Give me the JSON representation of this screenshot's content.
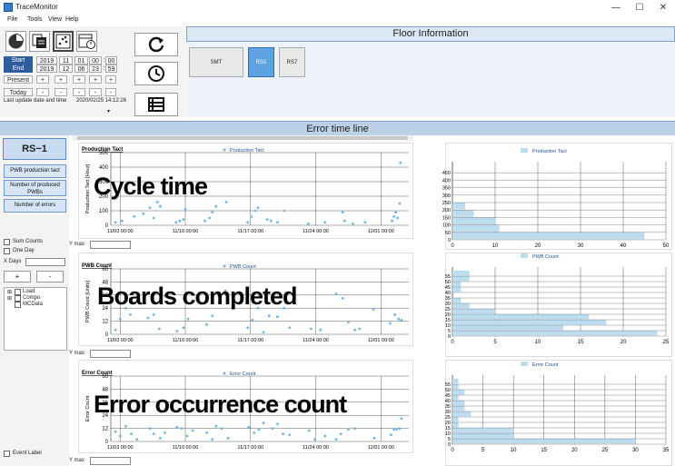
{
  "window": {
    "title": "TraceMonitor",
    "minimize": "—",
    "maximize": "☐",
    "close": "✕"
  },
  "menu": [
    "File",
    "Tools",
    "View",
    "Help"
  ],
  "time_grid": {
    "rows": [
      {
        "label": "Start",
        "cells": [
          "2019",
          "11",
          "01",
          "00",
          ":",
          "00"
        ]
      },
      {
        "label": "End",
        "cells": [
          "2019",
          "12",
          "06",
          "23",
          ":",
          "59"
        ]
      },
      {
        "label": "Present",
        "cells": [
          "+",
          "+",
          "+",
          "+",
          "+"
        ]
      },
      {
        "label": "Today",
        "cells": [
          "-",
          "-",
          "-",
          "-",
          "-"
        ]
      }
    ],
    "last_update_label": "Last update date and time",
    "last_update_value": "2020/02/25 14:12:26"
  },
  "floor": {
    "header": "Floor Information",
    "buttons": [
      "SMT",
      "RS1",
      "RS7"
    ],
    "selected": "RS1"
  },
  "timeline": {
    "header": "Error time line"
  },
  "left": {
    "station": "RS−1",
    "buttons": [
      "PWB production tact",
      "Number of produced PWBs",
      "Number of errors"
    ],
    "sum_counts": "Sum Counts",
    "one_day": "One Day",
    "x_days": "X Days",
    "plus": "+",
    "minus": "-",
    "tree": [
      "Load",
      "Compo",
      "MCData"
    ],
    "event_label": "Event Label"
  },
  "overlays": [
    "Cycle time",
    "Boards completed",
    "Error occurrence count"
  ],
  "ymax_label": "Y max",
  "colors": {
    "accent": "#6fb6de",
    "bar": "#bcdcef",
    "header": "#bcd0e8"
  },
  "chart_data": [
    {
      "type": "scatter",
      "title": "Production Tact",
      "legend": "Production Tact",
      "ylabel": "Production Tact [Hour]",
      "yticks": [
        0,
        100,
        200,
        300,
        400,
        500
      ],
      "ylim": [
        0,
        500
      ],
      "xticks": [
        "11/03 00:00",
        "11/10 00:00",
        "11/17 00:00",
        "11/24 00:00",
        "12/01 00:00"
      ],
      "x": [
        0.5,
        1.2,
        2.5,
        3.5,
        4.2,
        4.6,
        5.0,
        5.3,
        7.0,
        7.4,
        7.8,
        8.0,
        10.1,
        10.6,
        10.9,
        11.3,
        12.4,
        14.7,
        15.1,
        15.5,
        15.8,
        16.8,
        17.2,
        17.9,
        18.6,
        21.2,
        23.0,
        24.9,
        25.1,
        26.0,
        27.3,
        30.2,
        30.4,
        30.6,
        30.8,
        31.0,
        31.1
      ],
      "y": [
        20,
        30,
        60,
        80,
        120,
        50,
        160,
        130,
        20,
        30,
        40,
        110,
        30,
        50,
        90,
        130,
        160,
        20,
        60,
        100,
        120,
        40,
        30,
        20,
        100,
        10,
        20,
        90,
        30,
        10,
        20,
        30,
        60,
        90,
        50,
        150,
        430
      ]
    },
    {
      "type": "bar",
      "orientation": "horizontal",
      "legend": "Production Tact",
      "categories": [
        0,
        50,
        100,
        150,
        200,
        250,
        300,
        350,
        400,
        450
      ],
      "values": [
        45,
        11,
        10,
        5,
        3,
        0,
        0,
        0,
        0,
        0
      ],
      "xlim": [
        0,
        50
      ],
      "xticks": [
        0,
        10,
        20,
        30,
        40,
        50
      ]
    },
    {
      "type": "scatter",
      "title": "PWB Count",
      "legend": "PWB Count",
      "ylabel": "PWB Count [Units]",
      "yticks": [
        0,
        12,
        24,
        36,
        48,
        60
      ],
      "ylim": [
        0,
        60
      ],
      "xticks": [
        "11/03 00:00",
        "11/10 00:00",
        "11/17 00:00",
        "11/24 00:00",
        "12/01 00:00"
      ],
      "x": [
        0.5,
        1.0,
        1.6,
        2.1,
        4.0,
        4.6,
        5.2,
        5.8,
        7.1,
        7.8,
        8.3,
        10.3,
        10.9,
        11.6,
        12.3,
        14.7,
        15.2,
        15.8,
        16.4,
        17.0,
        17.9,
        18.6,
        19.2,
        21.5,
        22.5,
        24.2,
        24.9,
        25.5,
        26.2,
        26.7,
        28.2,
        30.0,
        30.5,
        30.9,
        31.2
      ],
      "y": [
        4,
        14,
        24,
        18,
        15,
        18,
        5,
        35,
        3,
        6,
        14,
        9,
        17,
        35,
        40,
        6,
        13,
        24,
        2,
        17,
        16,
        24,
        6,
        5,
        4,
        37,
        33,
        11,
        4,
        5,
        23,
        10,
        18,
        14,
        13
      ]
    },
    {
      "type": "bar",
      "orientation": "horizontal",
      "legend": "PWB Count",
      "categories": [
        0,
        5,
        10,
        15,
        20,
        25,
        30,
        35,
        40,
        45,
        50,
        55
      ],
      "values": [
        24,
        13,
        18,
        16,
        5,
        2,
        1,
        0,
        1,
        1,
        2,
        2
      ],
      "xlim": [
        0,
        25
      ],
      "xticks": [
        0,
        5,
        10,
        15,
        20,
        25
      ]
    },
    {
      "type": "scatter",
      "title": "Error Count",
      "legend": "Error Count",
      "ylabel": "Error Count",
      "yticks": [
        0,
        12,
        24,
        36,
        48,
        60
      ],
      "ylim": [
        0,
        60
      ],
      "xticks": [
        "11/03 00:00",
        "11/10 00:00",
        "11/17 00:00",
        "11/24 00:00",
        "12/01 00:00"
      ],
      "x": [
        0.5,
        1.0,
        1.6,
        2.2,
        2.8,
        4.2,
        4.6,
        5.3,
        5.8,
        7.1,
        7.6,
        8.2,
        8.8,
        10.3,
        10.9,
        11.3,
        11.9,
        12.6,
        14.8,
        15.4,
        15.9,
        16.4,
        17.4,
        17.9,
        18.5,
        19.2,
        21.3,
        21.9,
        23.0,
        24.2,
        24.7,
        25.5,
        26.2,
        28.3,
        30.1,
        30.4,
        30.7,
        31.0,
        31.2
      ],
      "y": [
        9,
        5,
        14,
        7,
        2,
        12,
        7,
        3,
        8,
        13,
        12,
        5,
        10,
        8,
        2,
        14,
        12,
        3,
        13,
        8,
        11,
        17,
        12,
        16,
        7,
        6,
        10,
        2,
        5,
        2,
        7,
        11,
        12,
        3,
        6,
        11,
        11,
        12,
        21
      ]
    },
    {
      "type": "bar",
      "orientation": "horizontal",
      "legend": "Error Count",
      "categories": [
        0,
        5,
        10,
        15,
        20,
        25,
        30,
        35,
        40,
        45,
        50,
        55
      ],
      "values": [
        30,
        10,
        10,
        1,
        1,
        3,
        2,
        2,
        1,
        2,
        1,
        1
      ],
      "xlim": [
        0,
        35
      ],
      "xticks": [
        0,
        5,
        10,
        15,
        20,
        25,
        30,
        35
      ]
    }
  ]
}
